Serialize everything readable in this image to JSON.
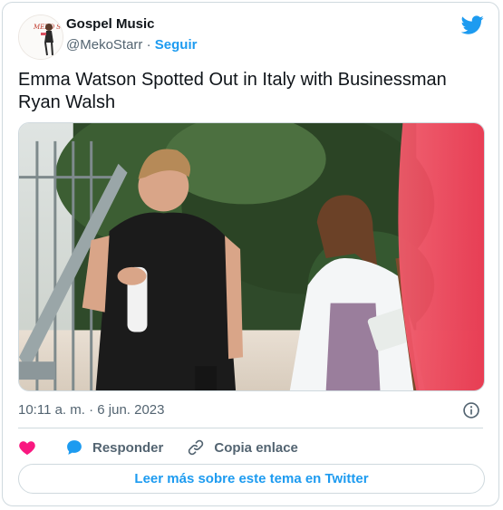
{
  "author": {
    "name": "Gospel Music",
    "handle": "@MekoStarr",
    "separator": "·",
    "follow_label": "Seguir",
    "avatar_text": "MEKO STARR"
  },
  "tweet": {
    "text": "Emma Watson Spotted Out in Italy with Businessman Ryan Walsh",
    "timestamp": "10:11 a. m. · 6 jun. 2023"
  },
  "actions": {
    "reply_label": "Responder",
    "copy_link_label": "Copia enlace"
  },
  "read_more_label": "Leer más sobre este tema en Twitter",
  "colors": {
    "twitter_blue": "#1d9bf0",
    "like_pink": "#f91880",
    "text_secondary": "#536471",
    "border": "#cfd9de"
  },
  "icons": {
    "brand": "twitter-bird-icon",
    "info": "info-icon",
    "like": "heart-icon",
    "reply": "speech-bubble-icon",
    "copy_link": "link-icon"
  }
}
